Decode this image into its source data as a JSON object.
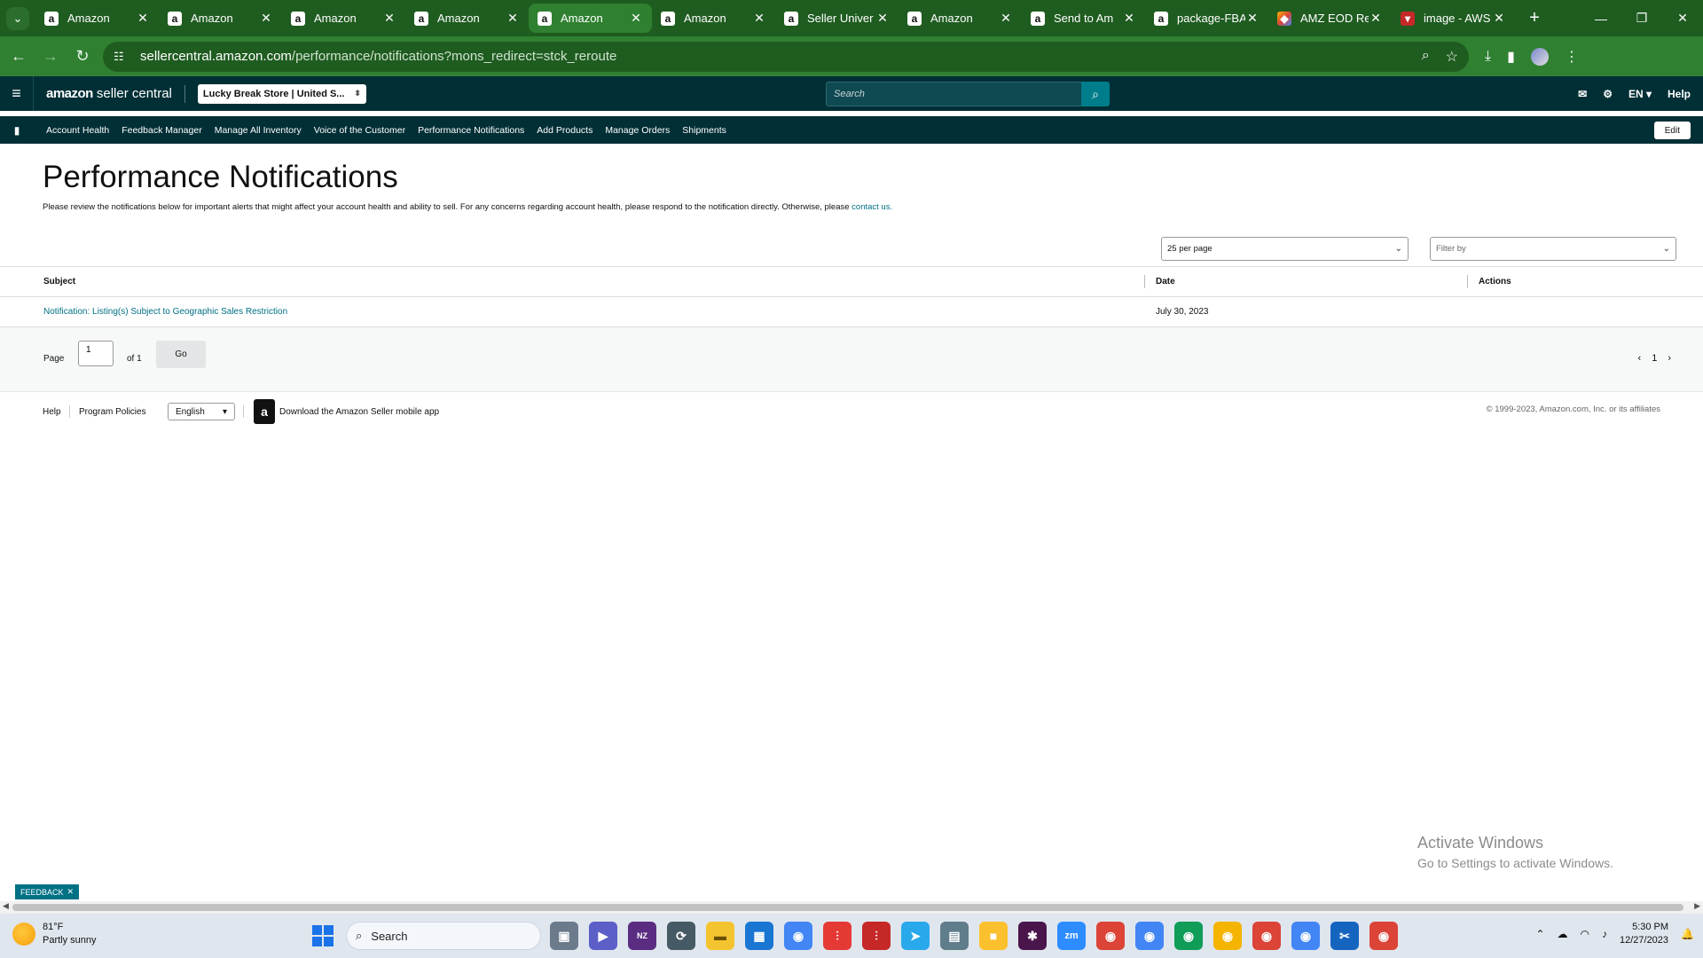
{
  "browser": {
    "tabs": [
      {
        "title": "Amazon",
        "favicon": "a",
        "active": false
      },
      {
        "title": "Amazon",
        "favicon": "a",
        "active": false
      },
      {
        "title": "Amazon",
        "favicon": "a",
        "active": false
      },
      {
        "title": "Amazon",
        "favicon": "a",
        "active": false
      },
      {
        "title": "Amazon",
        "favicon": "a",
        "active": true
      },
      {
        "title": "Amazon",
        "favicon": "a",
        "active": false
      },
      {
        "title": "Seller Univer",
        "favicon": "a",
        "active": false
      },
      {
        "title": "Amazon",
        "favicon": "a",
        "active": false
      },
      {
        "title": "Send to Am",
        "favicon": "a",
        "active": false
      },
      {
        "title": "package-FBA",
        "favicon": "a",
        "active": false
      },
      {
        "title": "AMZ EOD Re",
        "favicon": "multi",
        "active": false
      },
      {
        "title": "image - AWS",
        "favicon": "red",
        "active": false
      }
    ],
    "url_host": "sellercentral.amazon.com",
    "url_path": "/performance/notifications?mons_redirect=stck_reroute"
  },
  "header": {
    "logo_brand": "amazon",
    "logo_product": "seller central",
    "store": "Lucky Break Store | United S...",
    "search_placeholder": "Search",
    "language": "EN",
    "help": "Help"
  },
  "nav": {
    "items": [
      "Account Health",
      "Feedback Manager",
      "Manage All Inventory",
      "Voice of the Customer",
      "Performance Notifications",
      "Add Products",
      "Manage Orders",
      "Shipments"
    ],
    "edit": "Edit"
  },
  "page": {
    "title": "Performance Notifications",
    "intro": "Please review the notifications below for important alerts that might affect your account health and ability to sell. For any concerns regarding account health, please respond to the notification directly. Otherwise, please",
    "intro_link": "contact us.",
    "per_page": "25 per page",
    "filter_placeholder": "Filter by"
  },
  "table": {
    "columns": [
      "Subject",
      "Date",
      "Actions"
    ],
    "rows": [
      {
        "subject": "Notification: Listing(s) Subject to Geographic Sales Restriction",
        "date": "July 30, 2023",
        "actions": ""
      }
    ]
  },
  "pager": {
    "label": "Page",
    "value": "1",
    "of": "of 1",
    "go": "Go",
    "current": "1"
  },
  "footer": {
    "help": "Help",
    "program_policies": "Program Policies",
    "language": "English",
    "app": "Download the Amazon Seller mobile app",
    "copyright": "© 1999-2023, Amazon.com, Inc. or its affiliates"
  },
  "overlay": {
    "activate_title": "Activate Windows",
    "activate_sub": "Go to Settings to activate Windows.",
    "feedback": "FEEDBACK"
  },
  "taskbar": {
    "temp": "81°F",
    "weather": "Partly sunny",
    "search": "Search",
    "time": "5:30 PM",
    "date": "12/27/2023"
  },
  "colors": {
    "sc_header": "#002f36",
    "link": "#007185",
    "chrome_frame": "#1f5c20"
  }
}
